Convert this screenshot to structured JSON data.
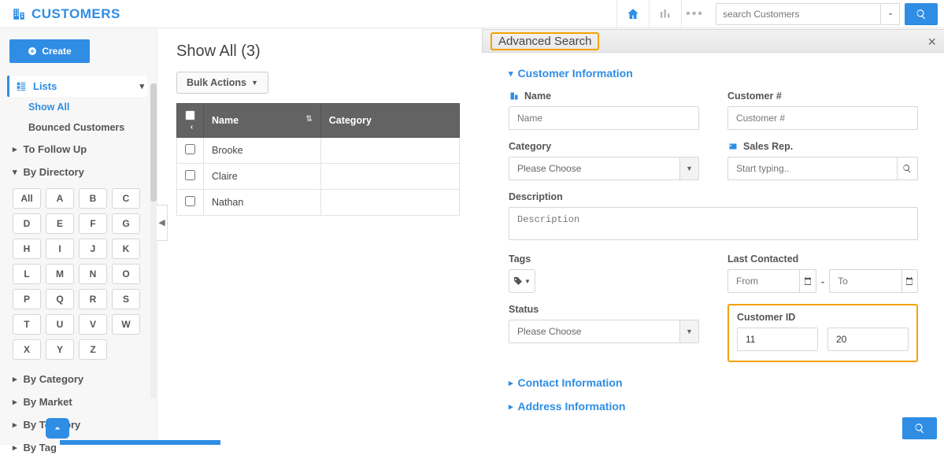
{
  "brand": "CUSTOMERS",
  "top_search_placeholder": "search Customers",
  "create_label": "Create",
  "sidebar": {
    "lists_label": "Lists",
    "show_all_label": "Show All",
    "bounced_label": "Bounced Customers",
    "follow_up_label": "To Follow Up",
    "by_directory_label": "By Directory",
    "directory": [
      "All",
      "A",
      "B",
      "C",
      "D",
      "E",
      "F",
      "G",
      "H",
      "I",
      "J",
      "K",
      "L",
      "M",
      "N",
      "O",
      "P",
      "Q",
      "R",
      "S",
      "T",
      "U",
      "V",
      "W",
      "X",
      "Y",
      "Z"
    ],
    "by_category_label": "By Category",
    "by_market_label": "By Market",
    "by_territory_label": "By Territory",
    "by_tag_label": "By Tag"
  },
  "main": {
    "title": "Show All (3)",
    "bulk_label": "Bulk Actions",
    "col_name": "Name",
    "col_category": "Category",
    "rows": [
      {
        "name": "Brooke"
      },
      {
        "name": "Claire"
      },
      {
        "name": "Nathan"
      }
    ]
  },
  "adv": {
    "title": "Advanced Search",
    "section_customer_info": "Customer Information",
    "section_contact_info": "Contact Information",
    "section_address_info": "Address Information",
    "name_label": "Name",
    "name_placeholder": "Name",
    "customer_num_label": "Customer #",
    "customer_num_placeholder": "Customer #",
    "category_label": "Category",
    "category_placeholder": "Please Choose",
    "salesrep_label": "Sales Rep.",
    "salesrep_placeholder": "Start typing..",
    "description_label": "Description",
    "description_placeholder": "Description",
    "tags_label": "Tags",
    "last_contacted_label": "Last Contacted",
    "from_placeholder": "From",
    "to_placeholder": "To",
    "status_label": "Status",
    "status_placeholder": "Please Choose",
    "customer_id_label": "Customer ID",
    "customer_id_from": "11",
    "customer_id_to": "20"
  }
}
